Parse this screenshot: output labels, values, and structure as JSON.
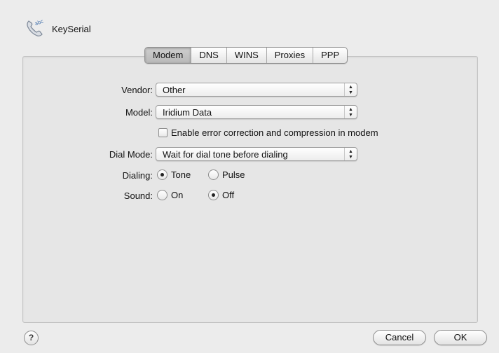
{
  "header": {
    "title": "KeySerial",
    "icon": "phone-handset-icon"
  },
  "tabs": [
    {
      "label": "Modem",
      "selected": true
    },
    {
      "label": "DNS",
      "selected": false
    },
    {
      "label": "WINS",
      "selected": false
    },
    {
      "label": "Proxies",
      "selected": false
    },
    {
      "label": "PPP",
      "selected": false
    }
  ],
  "form": {
    "vendor": {
      "label": "Vendor:",
      "value": "Other"
    },
    "model": {
      "label": "Model:",
      "value": "Iridium Data"
    },
    "error_correction": {
      "label": "Enable error correction and compression in modem",
      "checked": false
    },
    "dial_mode": {
      "label": "Dial Mode:",
      "value": "Wait for dial tone before dialing"
    },
    "dialing": {
      "label": "Dialing:",
      "options": [
        "Tone",
        "Pulse"
      ],
      "selected": "Tone"
    },
    "sound": {
      "label": "Sound:",
      "options": [
        "On",
        "Off"
      ],
      "selected": "Off"
    }
  },
  "footer": {
    "help": "?",
    "cancel": "Cancel",
    "ok": "OK"
  }
}
